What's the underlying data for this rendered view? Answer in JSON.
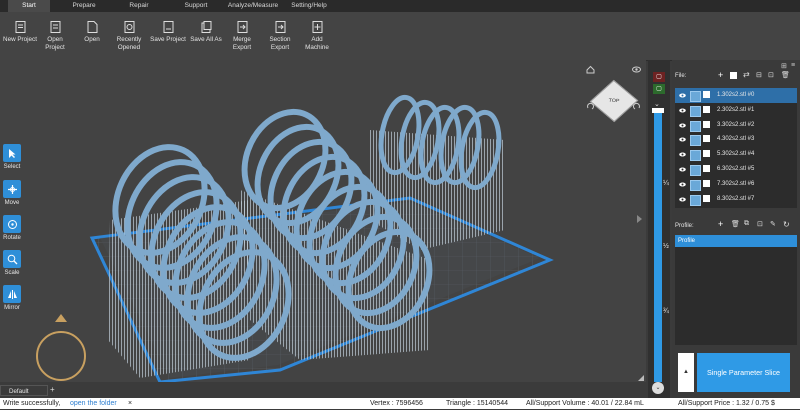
{
  "tabs": [
    {
      "label": "Start",
      "active": true
    },
    {
      "label": "Prepare"
    },
    {
      "label": "Repair"
    },
    {
      "label": "Support"
    },
    {
      "label": "Analyze/Measure"
    },
    {
      "label": "Setting/Help"
    }
  ],
  "toolbar": {
    "new_project": "New Project",
    "open_project": "Open\nProject",
    "open": "Open",
    "recently_opened": "Recently\nOpened",
    "save_project": "Save Project",
    "save_all_as": "Save All As",
    "merge_export": "Merge\nExport",
    "section_export": "Section\nExport",
    "add_machine": "Add\nMachine"
  },
  "tools": {
    "select": "Select",
    "move": "Move",
    "rotate": "Rotate",
    "scale": "Scale",
    "mirror": "Mirror"
  },
  "viewcube": {
    "face": "TOP"
  },
  "slider": {
    "q1": "¼",
    "half": "½",
    "q3": "¾"
  },
  "file_panel": {
    "label": "File:",
    "items": [
      {
        "name": "1.302s2.stl #0",
        "selected": true
      },
      {
        "name": "2.302s2.stl #1"
      },
      {
        "name": "3.302s2.stl #2"
      },
      {
        "name": "4.302s2.stl #3"
      },
      {
        "name": "5.302s2.stl #4"
      },
      {
        "name": "6.302s2.stl #5"
      },
      {
        "name": "7.302s2.stl #6"
      },
      {
        "name": "8.302s2.stl #7"
      }
    ]
  },
  "profile_panel": {
    "label": "Profile:",
    "items": [
      "Profile"
    ]
  },
  "slice": {
    "button": "Single Parameter Slice"
  },
  "bottom_tabs": {
    "default": "Default",
    "add": "+"
  },
  "status": {
    "message": "Write successfully,",
    "link": "open the folder",
    "close": "×",
    "vertex": "Vertex : 7596456",
    "triangle": "Triangle : 15140544",
    "volume": "All/Support Volume : 40.01 / 22.84 mL",
    "price": "All/Support Price : 1.32 / 0.75 $"
  },
  "colors": {
    "accent": "#2f9ae6",
    "model": "#7fa9cc",
    "support": "#b7c9d6",
    "plate": "#2f86d6"
  }
}
